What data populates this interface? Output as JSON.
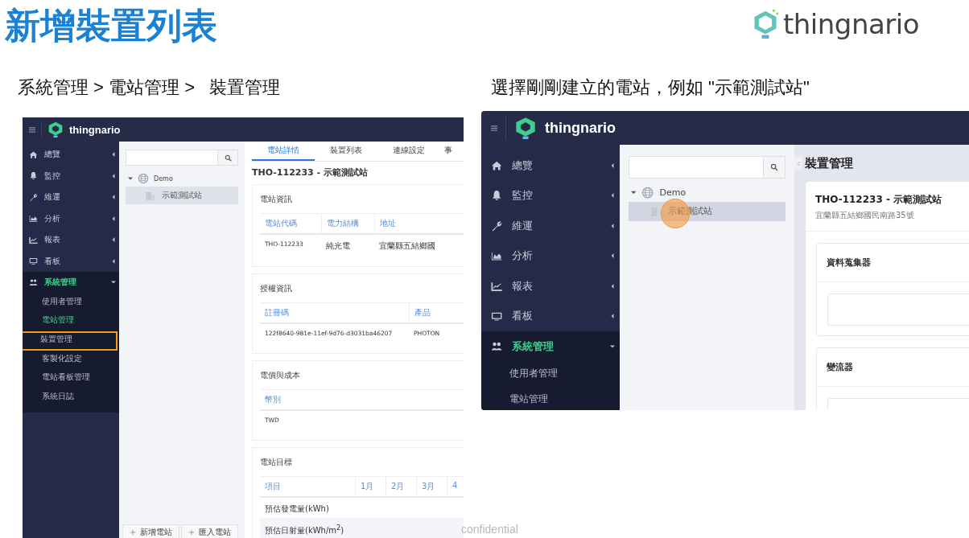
{
  "title": "新增裝置列表",
  "logo": {
    "text": "thingnario"
  },
  "captions": [
    "系統管理 > 電站管理 >   裝置管理",
    "選擇剛剛建立的電站，例如 \"示範測試站\""
  ],
  "screens": [
    {
      "kind": "station_detail",
      "brand": "thingnario",
      "nav": [
        {
          "label": "總覽",
          "kind": "home",
          "expanded": false,
          "selected": false
        },
        {
          "label": "監控",
          "kind": "bell",
          "expanded": false,
          "selected": false
        },
        {
          "label": "維運",
          "kind": "wrench",
          "expanded": false,
          "selected": false
        },
        {
          "label": "分析",
          "kind": "area",
          "expanded": false,
          "selected": false
        },
        {
          "label": "報表",
          "kind": "line",
          "expanded": false,
          "selected": false
        },
        {
          "label": "看板",
          "kind": "monitor",
          "expanded": false,
          "selected": false
        },
        {
          "label": "系統管理",
          "kind": "users",
          "expanded": true,
          "selected": true,
          "children": [
            {
              "label": "使用者管理",
              "selected": false,
              "highlighted": false
            },
            {
              "label": "電站管理",
              "selected": true,
              "highlighted": false
            },
            {
              "label": "裝置管理",
              "selected": false,
              "highlighted": true
            },
            {
              "label": "客製化設定",
              "selected": false,
              "highlighted": false
            },
            {
              "label": "電站看板管理",
              "selected": false,
              "highlighted": false
            },
            {
              "label": "系統日誌",
              "selected": false,
              "highlighted": false
            }
          ]
        }
      ],
      "tree": [
        {
          "label": "Demo",
          "expanded": true,
          "children": [
            {
              "label": "示範測試站",
              "selected": true,
              "tapped": false
            }
          ]
        }
      ],
      "buttons": [
        "新增電站",
        "匯入電站"
      ],
      "tabs": [
        {
          "label": "電站詳情",
          "selected": true
        },
        {
          "label": "裝置列表",
          "selected": false
        },
        {
          "label": "連線設定",
          "selected": false
        },
        {
          "label": "事",
          "selected": false
        }
      ],
      "heading": "THO-112233 - 示範測試站",
      "sections": [
        {
          "title": "電站資訊",
          "columns": [
            "電站代碼",
            "電力結構",
            "地址"
          ],
          "rows": [
            [
              "THO-112233",
              "純光電",
              "宜蘭縣五結鄉國"
            ]
          ]
        },
        {
          "title": "授權資訊",
          "columns": [
            "註冊碼",
            "產品"
          ],
          "rows": [
            [
              "122f8640-981e-11ef-9d76-d3031ba46207",
              "PHOTON"
            ]
          ]
        },
        {
          "title": "電價與成本",
          "columns": [
            "幣別"
          ],
          "rows": [
            [
              "TWD"
            ]
          ]
        },
        {
          "title": "電站目標",
          "columns": [
            "項目",
            "1月",
            "2月",
            "3月",
            "4"
          ],
          "rows": [
            [
              "預估發電量(kWh)"
            ],
            [
              "預估日射量(kWh/m$^{2}$)"
            ]
          ]
        }
      ]
    },
    {
      "kind": "device_manager",
      "brand": "thingnario",
      "nav": [
        {
          "label": "總覽",
          "kind": "home",
          "expanded": false,
          "selected": false
        },
        {
          "label": "監控",
          "kind": "bell",
          "expanded": false,
          "selected": false
        },
        {
          "label": "維運",
          "kind": "wrench",
          "expanded": false,
          "selected": false
        },
        {
          "label": "分析",
          "kind": "area",
          "expanded": false,
          "selected": false
        },
        {
          "label": "報表",
          "kind": "line",
          "expanded": false,
          "selected": false
        },
        {
          "label": "看板",
          "kind": "monitor",
          "expanded": false,
          "selected": false
        },
        {
          "label": "系統管理",
          "kind": "users",
          "expanded": true,
          "selected": true,
          "children": [
            {
              "label": "使用者管理",
              "selected": false,
              "highlighted": false
            },
            {
              "label": "電站管理",
              "selected": false,
              "highlighted": false
            }
          ]
        }
      ],
      "tree": [
        {
          "label": "Demo",
          "expanded": true,
          "children": [
            {
              "label": "示範測試站",
              "selected": true,
              "tapped": true
            }
          ]
        }
      ],
      "heading": "裝置管理",
      "station": {
        "name": "THO-112233 - 示範測試站",
        "address": "宜蘭縣五結鄉國民南路35號"
      },
      "sections": [
        {
          "title": "資料蒐集器"
        },
        {
          "title": "變流器"
        }
      ]
    }
  ],
  "footer": "confidential"
}
